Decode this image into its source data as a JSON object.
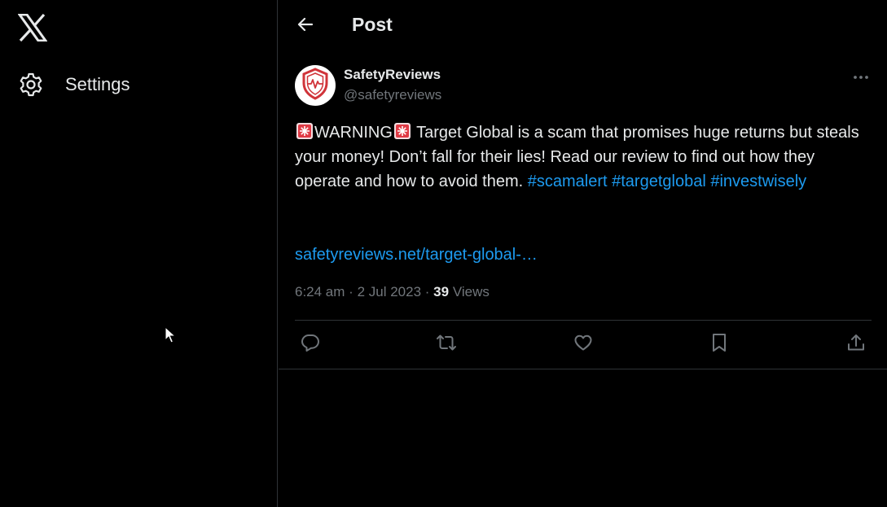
{
  "sidebar": {
    "logo_icon": "x-logo-icon",
    "items": [
      {
        "label": "Settings",
        "icon": "gear-icon"
      }
    ]
  },
  "header": {
    "back_icon": "arrow-left-icon",
    "title": "Post"
  },
  "post": {
    "author": {
      "display_name": "SafetyReviews",
      "handle": "@safetyreviews",
      "avatar_icon": "shield-heartbeat-icon"
    },
    "text_parts": [
      "WARNING",
      " Target Global is a scam that promises huge returns but steals your money! Don’t fall for their lies! Read our review to find out how they operate and how to avoid them. "
    ],
    "emoji_icon": "police-siren-icon",
    "hashtags": [
      "#scamalert",
      "#targetglobal",
      "#investwisely"
    ],
    "link": "safetyreviews.net/target-global-…",
    "time": "6:24 am",
    "date": "2 Jul 2023",
    "views_count": "39",
    "views_label": "Views",
    "separator": "·"
  },
  "actions": [
    {
      "name": "reply",
      "icon": "speech-bubble-icon"
    },
    {
      "name": "repost",
      "icon": "repost-arrows-icon"
    },
    {
      "name": "like",
      "icon": "heart-icon"
    },
    {
      "name": "bookmark",
      "icon": "bookmark-icon"
    },
    {
      "name": "share",
      "icon": "share-upload-icon"
    }
  ],
  "colors": {
    "background": "#000000",
    "text": "#e7e9ea",
    "muted": "#71767b",
    "link": "#1d9bf0",
    "border": "#2f3336"
  }
}
